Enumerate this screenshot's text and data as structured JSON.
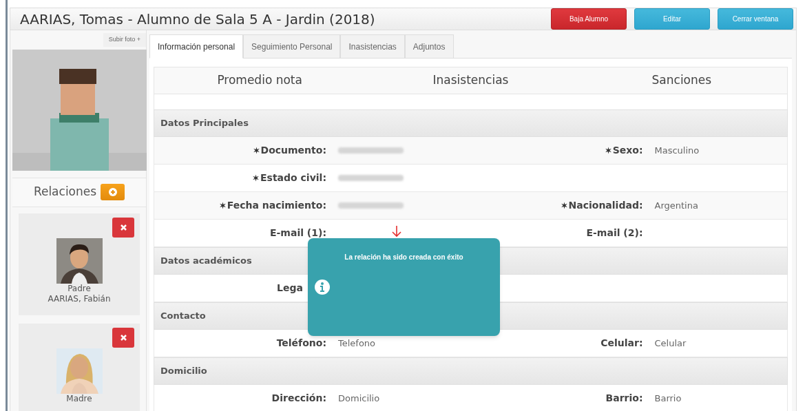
{
  "header": {
    "title": "AARIAS, Tomas - Alumno de Sala 5 A - Jardin (2018)",
    "buttons": [
      {
        "label": "Baja Alumno",
        "kind": "danger"
      },
      {
        "label": "Editar",
        "kind": "info"
      },
      {
        "label": "Cerrar ventana",
        "kind": "info"
      }
    ]
  },
  "sidebar": {
    "upload_label": "Subir foto +",
    "relations_title": "Relaciones",
    "relations": [
      {
        "role": "Padre",
        "name": "AARIAS, Fabián",
        "kind": "man"
      },
      {
        "role": "Madre",
        "kind": "woman"
      }
    ]
  },
  "tabs": [
    {
      "label": "Información personal",
      "selected": true
    },
    {
      "label": "Seguimiento Personal",
      "selected": false
    },
    {
      "label": "Inasistencias",
      "selected": false
    },
    {
      "label": "Adjuntos",
      "selected": false
    }
  ],
  "summary": [
    "Promedio nota",
    "Inasistencias",
    "Sanciones"
  ],
  "rows": [
    {
      "kind": "section",
      "title": "Datos Principales"
    },
    {
      "kind": "fields",
      "fields": [
        {
          "label": "Documento:",
          "required": true,
          "blurred": true
        },
        {
          "label": "Sexo:",
          "required": true,
          "value": "Masculino"
        }
      ]
    },
    {
      "kind": "fields",
      "fields": [
        {
          "label": "Estado civil:",
          "required": true,
          "blurred": true
        }
      ]
    },
    {
      "kind": "fields",
      "fields": [
        {
          "label": "Fecha nacimiento:",
          "required": true,
          "blurred": true
        },
        {
          "label": "Nacionalidad:",
          "required": true,
          "value": "Argentina"
        }
      ]
    },
    {
      "kind": "fields",
      "fields": [
        {
          "label": "E-mail (1):",
          "required": false
        },
        {
          "label": "E-mail (2):",
          "required": false
        }
      ]
    },
    {
      "kind": "section",
      "title": "Datos académicos"
    },
    {
      "kind": "fields",
      "fields": [
        {
          "label": "Lega",
          "required": false,
          "covered": true
        }
      ]
    },
    {
      "kind": "section",
      "title": "Contacto"
    },
    {
      "kind": "fields",
      "fields": [
        {
          "label": "Teléfono:",
          "required": false,
          "value": "Telefono"
        },
        {
          "label": "Celular:",
          "required": false,
          "value": "Celular"
        }
      ]
    },
    {
      "kind": "section",
      "title": "Domicilio"
    },
    {
      "kind": "fields",
      "fields": [
        {
          "label": "Dirección:",
          "required": false,
          "value": "Domicilio"
        },
        {
          "label": "Barrio:",
          "required": false,
          "value": "Barrio"
        }
      ]
    }
  ],
  "toast": {
    "message": "La relación ha sido creada con éxito"
  }
}
